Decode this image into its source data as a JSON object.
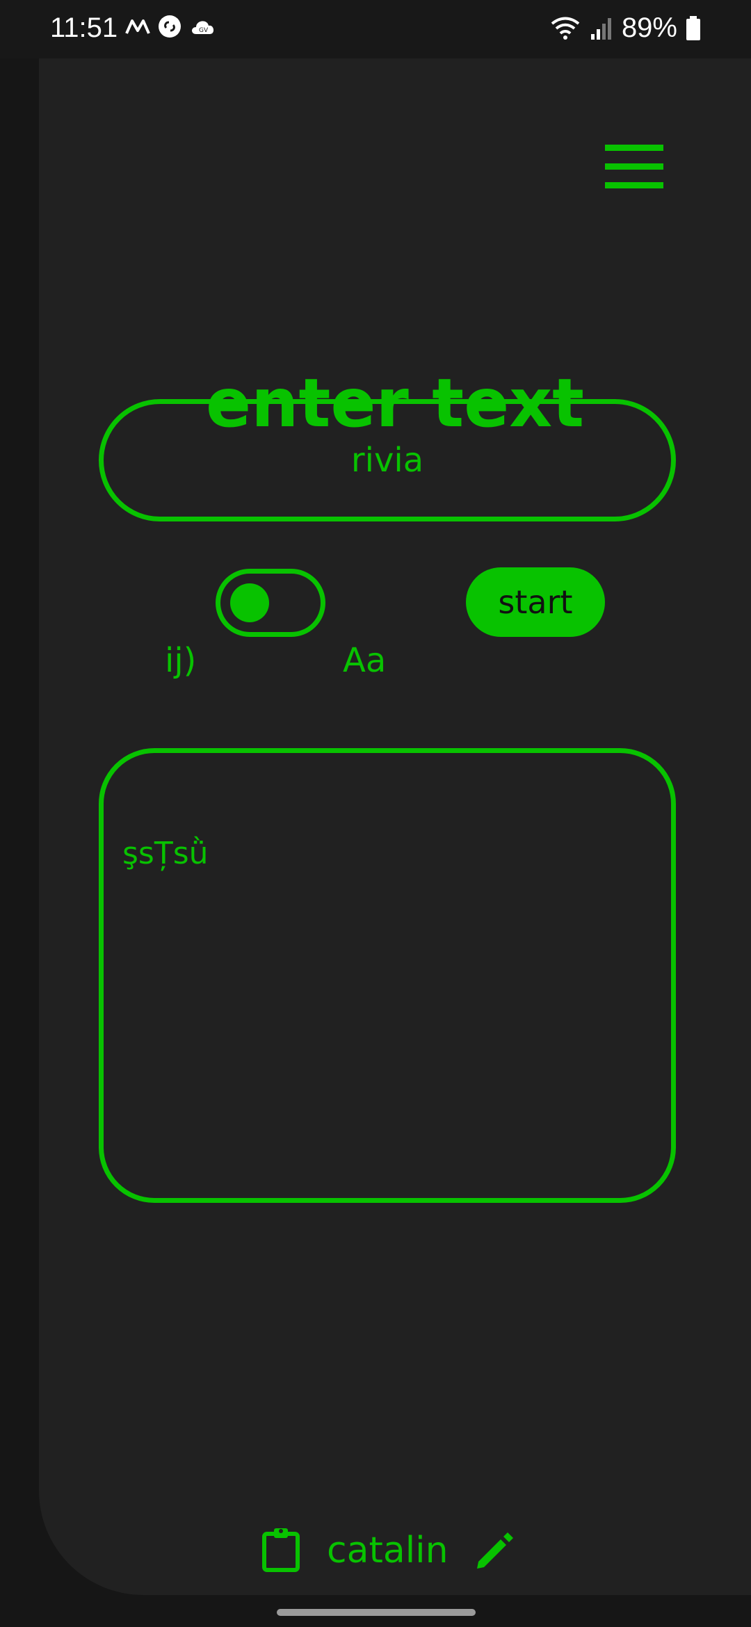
{
  "status_bar": {
    "time": "11:51",
    "battery_percent": "89%",
    "left_icons": [
      "m-logo-icon",
      "shazam-icon",
      "cloud-icon"
    ],
    "right_icons": [
      "wifi-icon",
      "signal-icon",
      "battery-icon"
    ]
  },
  "app": {
    "title": "enter text",
    "input": {
      "value": "rivia",
      "placeholder": ""
    },
    "toggle": {
      "left_label": "ij)",
      "right_label": "Aa",
      "state": "left"
    },
    "start_label": "start",
    "output_text": "şsȚsǜ",
    "footer": {
      "name": "catalin",
      "left_icon": "clipboard-icon",
      "right_icon": "pencil-icon"
    }
  },
  "colors": {
    "accent": "#08c200",
    "background": "#212121",
    "outer_background": "#161616"
  }
}
